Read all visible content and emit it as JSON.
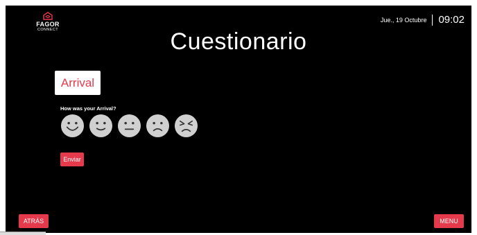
{
  "brand": {
    "name": "FAGOR",
    "sub": "CONNECT",
    "icon": "fagor-logo-icon"
  },
  "header": {
    "date": "Jue., 19 Octubre",
    "time": "09:02"
  },
  "page": {
    "title": "Cuestionario"
  },
  "section": {
    "label": "Arrival"
  },
  "question": {
    "text": "How was your Arrival?"
  },
  "faces": [
    "very-happy-face-icon",
    "happy-face-icon",
    "neutral-face-icon",
    "sad-face-icon",
    "angry-face-icon"
  ],
  "buttons": {
    "send": "Enviar",
    "back": "ATRÁS",
    "menu": "MENU"
  },
  "colors": {
    "accent": "#e43a4c",
    "background": "#000000",
    "face": "#d0d0d0"
  }
}
